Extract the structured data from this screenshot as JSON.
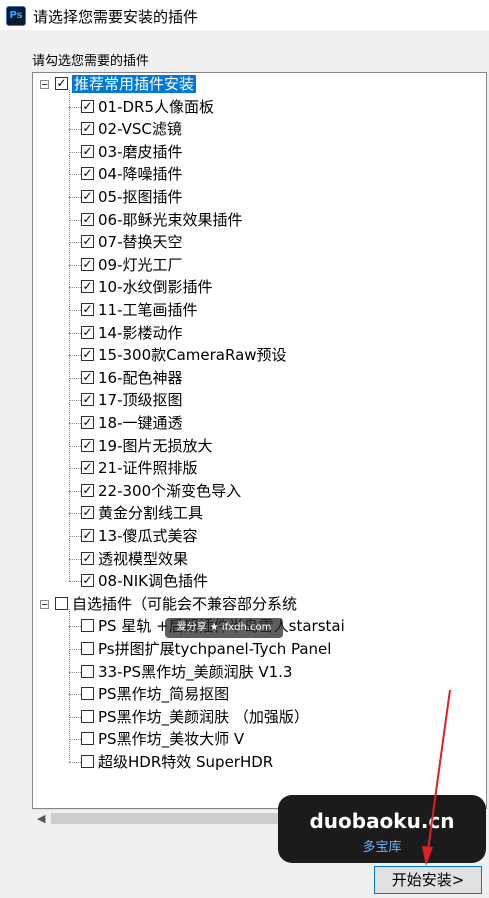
{
  "window": {
    "title": "请选择您需要安装的插件",
    "app_icon": "Ps"
  },
  "prompt": "请勾选您需要的插件",
  "groups": [
    {
      "label": "推荐常用插件安装",
      "checked": true,
      "selected": true,
      "items": [
        "01-DR5人像面板",
        "02-VSC滤镜",
        "03-磨皮插件",
        "04-降噪插件",
        "05-抠图插件",
        "06-耶稣光束效果插件",
        "07-替换天空",
        "09-灯光工厂",
        "10-水纹倒影插件",
        "11-工笔画插件",
        "14-影楼动作",
        "15-300款CameraRaw预设",
        "16-配色神器",
        "17-顶级抠图",
        "18-一键通透",
        "19-图片无损放大",
        "21-证件照排版",
        "22-300个渐变色导入",
        "黄金分割线工具",
        "13-傻瓜式美容",
        "透视模型效果",
        "08-NIK调色插件"
      ]
    },
    {
      "label": "自选插件（可能会不兼容部分系统",
      "checked": false,
      "items": [
        "PS 星轨 +后期插件半岛雪人starstai",
        "Ps拼图扩展tychpanel-Tych Panel",
        "33-PS黑作坊_美颜润肤 V1.3",
        "PS黑作坊_简易抠图",
        "PS黑作坊_美颜润肤 （加强版）",
        "PS黑作坊_美妆大师 V",
        "超级HDR特效 SuperHDR"
      ]
    }
  ],
  "next_button": "开始安装>",
  "watermarks": {
    "small": "爱分享 ★ ifxdh.com",
    "big_line1": "duobaoku.cn",
    "big_line2": "多宝库"
  },
  "colors": {
    "selection": "#0078d7",
    "arrow": "#e02020",
    "brand_blue": "#67b3ff"
  },
  "icons": [
    "ps-app-icon",
    "expander-minus-icon",
    "checkbox-icon",
    "scroll-left-arrow-icon"
  ]
}
